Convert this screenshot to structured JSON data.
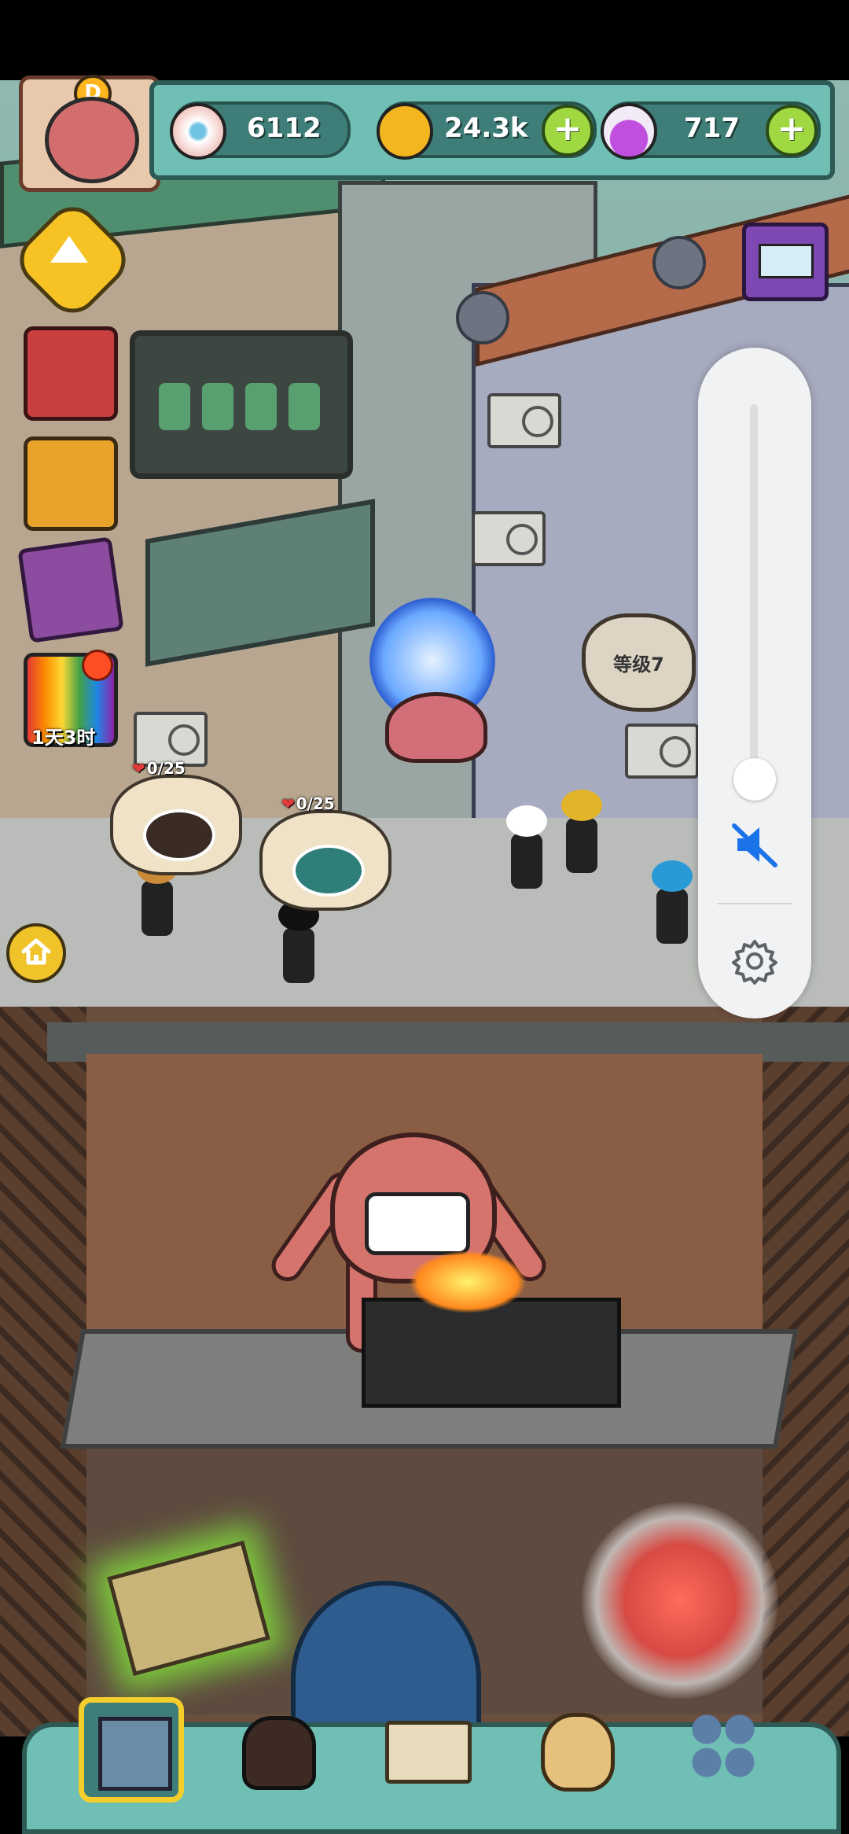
{
  "resources": {
    "eyeballs": "6112",
    "coins": "24.3k",
    "potions": "717"
  },
  "timer_label": "1天3时",
  "level_bubble": "等级7",
  "orders": [
    {
      "count": "0/25"
    },
    {
      "count": "0/25"
    }
  ],
  "avatar_grade": "D",
  "colors": {
    "ui_teal": "#6fbfb4",
    "plus_green": "#9fd840",
    "nav_selected_border": "#f4cf2c",
    "mute_blue": "#1a73e8"
  },
  "volume": {
    "level": 0,
    "muted": true
  },
  "nav": {
    "selected": "shop"
  }
}
